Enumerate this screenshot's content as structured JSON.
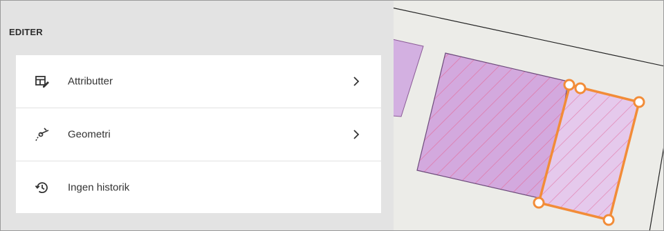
{
  "panel": {
    "title": "EDITER",
    "items": [
      {
        "label": "Attributter",
        "icon": "table-edit-icon",
        "has_chevron": true
      },
      {
        "label": "Geometri",
        "icon": "geometry-edit-icon",
        "has_chevron": true
      },
      {
        "label": "Ingen historik",
        "icon": "history-icon",
        "has_chevron": false
      }
    ]
  },
  "colors": {
    "panel_bg": "#e3e3e3",
    "menu_bg": "#ffffff",
    "polygon_fill": "#d6aee0",
    "polygon_hatch": "#e36aa8",
    "selection": "#f28c38"
  }
}
